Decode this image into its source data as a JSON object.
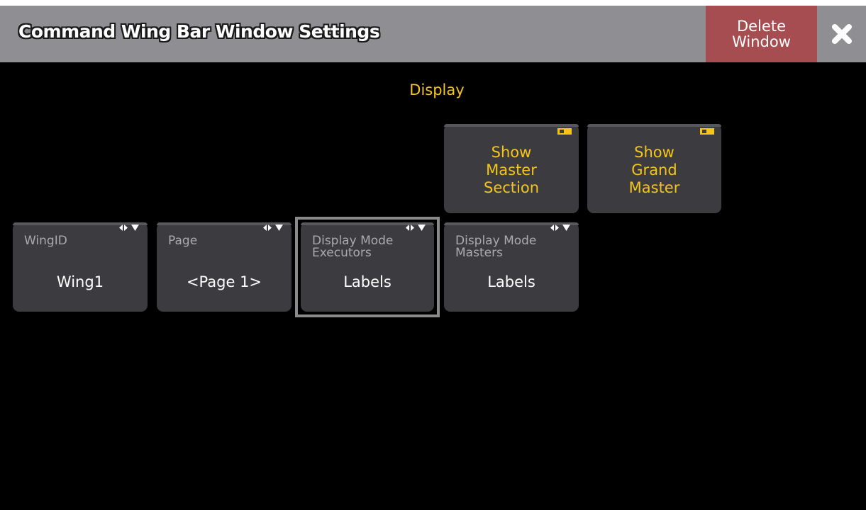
{
  "window": {
    "title": "Command Wing Bar Window Settings",
    "delete_button": {
      "line1": "Delete",
      "line2": "Window"
    },
    "close_icon": "close-x-icon"
  },
  "section": {
    "title": "Display"
  },
  "toggles": [
    {
      "line1": "Show",
      "line2": "Master",
      "line3": "Section"
    },
    {
      "line1": "Show",
      "line2": "Grand",
      "line3": "Master"
    }
  ],
  "settings": [
    {
      "caption1": "WingID",
      "caption2": "",
      "value": "Wing1"
    },
    {
      "caption1": "Page",
      "caption2": "",
      "value": "<Page 1>"
    },
    {
      "caption1": "Display Mode",
      "caption2": "Executors",
      "value": "Labels"
    },
    {
      "caption1": "Display Mode",
      "caption2": "Masters",
      "value": "Labels"
    }
  ],
  "colors": {
    "accent": "#f5c518",
    "titlebar": "#8e8e93",
    "delete": "#a54d50",
    "button": "#3c3c40"
  }
}
